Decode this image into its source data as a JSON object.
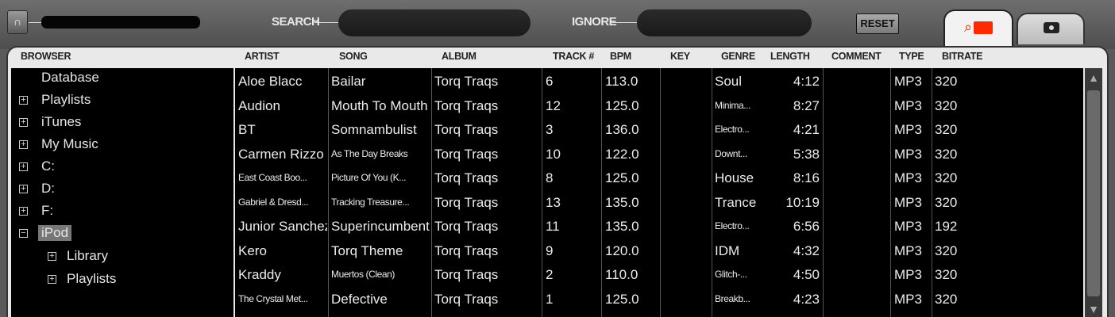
{
  "toolbar": {
    "headphones_icon": "headphones-icon",
    "search_label": "SEARCH",
    "search_value": "",
    "ignore_label": "IGNORE",
    "ignore_value": "",
    "reset_label": "RESET"
  },
  "tabs": {
    "browser_icons": [
      "search-icon",
      "folder-icon"
    ],
    "camera_icon": "camera-icon"
  },
  "headers": {
    "browser": "BROWSER",
    "artist": "ARTIST",
    "song": "SONG",
    "album": "ALBUM",
    "track": "TRACK #",
    "bpm": "BPM",
    "key": "KEY",
    "genre": "GENRE",
    "length": "LENGTH",
    "comment": "COMMENT",
    "type": "TYPE",
    "bitrate": "BITRATE"
  },
  "tree": [
    {
      "label": "Database",
      "expander": ""
    },
    {
      "label": "Playlists",
      "expander": "+"
    },
    {
      "label": "iTunes",
      "expander": "+"
    },
    {
      "label": "My Music",
      "expander": "+"
    },
    {
      "label": "C:",
      "expander": "+"
    },
    {
      "label": "D:",
      "expander": "+"
    },
    {
      "label": "F:",
      "expander": "+"
    },
    {
      "label": "iPod",
      "expander": "−"
    },
    {
      "label": "Library",
      "expander": "+"
    },
    {
      "label": "Playlists",
      "expander": "+"
    }
  ],
  "tracks": [
    {
      "artist": "Aloe Blacc",
      "song": "Bailar",
      "album": "Torq Traqs",
      "track": "6",
      "bpm": "113.0",
      "key": "",
      "genre": "Soul",
      "length": "4:12",
      "comment": "",
      "type": "MP3",
      "bitrate": "320"
    },
    {
      "artist": "Audion",
      "song": "Mouth To Mouth",
      "album": "Torq Traqs",
      "track": "12",
      "bpm": "125.0",
      "key": "",
      "genre": "Minima...",
      "length": "8:27",
      "comment": "",
      "type": "MP3",
      "bitrate": "320"
    },
    {
      "artist": "BT",
      "song": "Somnambulist",
      "album": "Torq Traqs",
      "track": "3",
      "bpm": "136.0",
      "key": "",
      "genre": "Electro...",
      "length": "4:21",
      "comment": "",
      "type": "MP3",
      "bitrate": "320"
    },
    {
      "artist": "Carmen Rizzo",
      "song": "As The Day Breaks",
      "album": "Torq Traqs",
      "track": "10",
      "bpm": "122.0",
      "key": "",
      "genre": "Downt...",
      "length": "5:38",
      "comment": "",
      "type": "MP3",
      "bitrate": "320"
    },
    {
      "artist": "East Coast Boo...",
      "song": "Picture Of You (K...",
      "album": "Torq Traqs",
      "track": "8",
      "bpm": "125.0",
      "key": "",
      "genre": "House",
      "length": "8:16",
      "comment": "",
      "type": "MP3",
      "bitrate": "320"
    },
    {
      "artist": "Gabriel & Dresd...",
      "song": "Tracking Treasure...",
      "album": "Torq Traqs",
      "track": "13",
      "bpm": "135.0",
      "key": "",
      "genre": "Trance",
      "length": "10:19",
      "comment": "",
      "type": "MP3",
      "bitrate": "320"
    },
    {
      "artist": "Junior Sanchez",
      "song": "Superincumbent",
      "album": "Torq Traqs",
      "track": "11",
      "bpm": "135.0",
      "key": "",
      "genre": "Electro...",
      "length": "6:56",
      "comment": "",
      "type": "MP3",
      "bitrate": "192"
    },
    {
      "artist": "Kero",
      "song": "Torq Theme",
      "album": "Torq Traqs",
      "track": "9",
      "bpm": "120.0",
      "key": "",
      "genre": "IDM",
      "length": "4:32",
      "comment": "",
      "type": "MP3",
      "bitrate": "320"
    },
    {
      "artist": "Kraddy",
      "song": "Muertos (Clean)",
      "album": "Torq Traqs",
      "track": "2",
      "bpm": "110.0",
      "key": "",
      "genre": "Glitch-...",
      "length": "4:50",
      "comment": "",
      "type": "MP3",
      "bitrate": "320"
    },
    {
      "artist": "The Crystal Met...",
      "song": "Defective",
      "album": "Torq Traqs",
      "track": "1",
      "bpm": "125.0",
      "key": "",
      "genre": "Breakb...",
      "length": "4:23",
      "comment": "",
      "type": "MP3",
      "bitrate": "320"
    }
  ]
}
